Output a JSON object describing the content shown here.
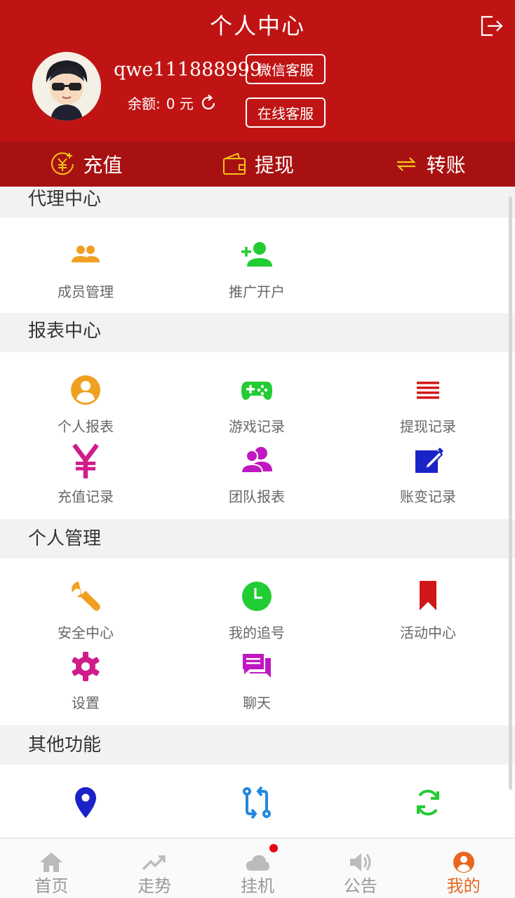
{
  "header": {
    "title": "个人中心",
    "username": "qwe111888999",
    "balance_label": "余额:",
    "balance_value": "0 元",
    "wechat_service": "微信客服",
    "online_service": "在线客服",
    "logout_icon": "logout-icon",
    "bg_color": "#c01414"
  },
  "actions": [
    {
      "label": "充值",
      "icon": "yuan-circle-icon"
    },
    {
      "label": "提现",
      "icon": "wallet-icon"
    },
    {
      "label": "转账",
      "icon": "transfer-icon"
    }
  ],
  "sections": [
    {
      "title": "代理中心",
      "items": [
        {
          "label": "成员管理",
          "icon": "members-icon",
          "color": "#f0a020"
        },
        {
          "label": "推广开户",
          "icon": "add-user-icon",
          "color": "#22cc33"
        }
      ]
    },
    {
      "title": "报表中心",
      "items": [
        {
          "label": "个人报表",
          "icon": "user-circle-icon",
          "color": "#f0a020"
        },
        {
          "label": "游戏记录",
          "icon": "gamepad-icon",
          "color": "#22cc33"
        },
        {
          "label": "提现记录",
          "icon": "list-lines-icon",
          "color": "#d01818"
        },
        {
          "label": "充值记录",
          "icon": "yen-icon",
          "color": "#d01c8b"
        },
        {
          "label": "团队报表",
          "icon": "team-icon",
          "color": "#c018c0"
        },
        {
          "label": "账变记录",
          "icon": "edit-icon",
          "color": "#1a22c8"
        }
      ]
    },
    {
      "title": "个人管理",
      "items": [
        {
          "label": "安全中心",
          "icon": "wrench-icon",
          "color": "#f0a020"
        },
        {
          "label": "我的追号",
          "icon": "clock-icon",
          "color": "#22cc33"
        },
        {
          "label": "活动中心",
          "icon": "bookmark-icon",
          "color": "#d01818"
        },
        {
          "label": "设置",
          "icon": "gear-icon",
          "color": "#d01c8b"
        },
        {
          "label": "聊天",
          "icon": "chat-icon",
          "color": "#c018c0"
        }
      ]
    },
    {
      "title": "其他功能",
      "items": [
        {
          "label": "",
          "icon": "location-pin-icon",
          "color": "#1a22c8"
        },
        {
          "label": "",
          "icon": "switch-lines-icon",
          "color": "#2288dd"
        },
        {
          "label": "",
          "icon": "refresh-arrows-icon",
          "color": "#22cc33"
        }
      ]
    }
  ],
  "tabs": [
    {
      "label": "首页",
      "icon": "home-icon"
    },
    {
      "label": "走势",
      "icon": "trend-icon"
    },
    {
      "label": "挂机",
      "icon": "cloud-icon"
    },
    {
      "label": "公告",
      "icon": "speaker-icon"
    },
    {
      "label": "我的",
      "icon": "profile-icon"
    }
  ],
  "active_color": "#e8661e"
}
